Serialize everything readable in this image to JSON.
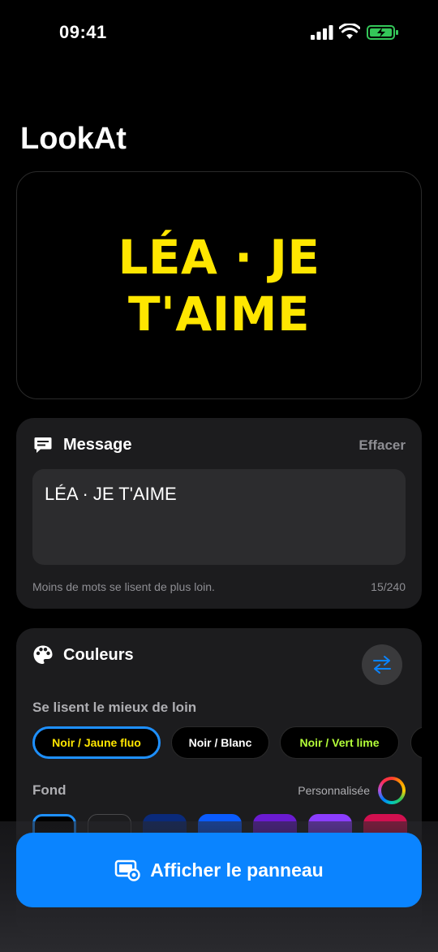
{
  "status": {
    "time": "09:41"
  },
  "app": {
    "title": "LookAt"
  },
  "preview": {
    "text": "LÉA · JE T'AIME",
    "text_color": "#FFE600",
    "background": "#000000"
  },
  "message": {
    "label": "Message",
    "clear_label": "Effacer",
    "value": "LÉA · JE T'AIME",
    "hint": "Moins de mots se lisent de plus loin.",
    "counter": "15/240"
  },
  "colors": {
    "label": "Couleurs",
    "recommended_label": "Se lisent le mieux de loin",
    "presets": [
      {
        "label": "Noir / Jaune fluo",
        "text_color": "#FFE600",
        "selected": true
      },
      {
        "label": "Noir / Blanc",
        "text_color": "#FFFFFF",
        "selected": false
      },
      {
        "label": "Noir / Vert lime",
        "text_color": "#B4FF39",
        "selected": false
      }
    ],
    "background_label": "Fond",
    "custom_label": "Personnalisée",
    "swatches": [
      "#000000",
      "#1c1c1e",
      "#0a2a7a",
      "#0a5cff",
      "#6a1bd1",
      "#8b3dff",
      "#d1104f"
    ]
  },
  "cta": {
    "label": "Afficher le panneau"
  },
  "accent": "#0A84FF"
}
